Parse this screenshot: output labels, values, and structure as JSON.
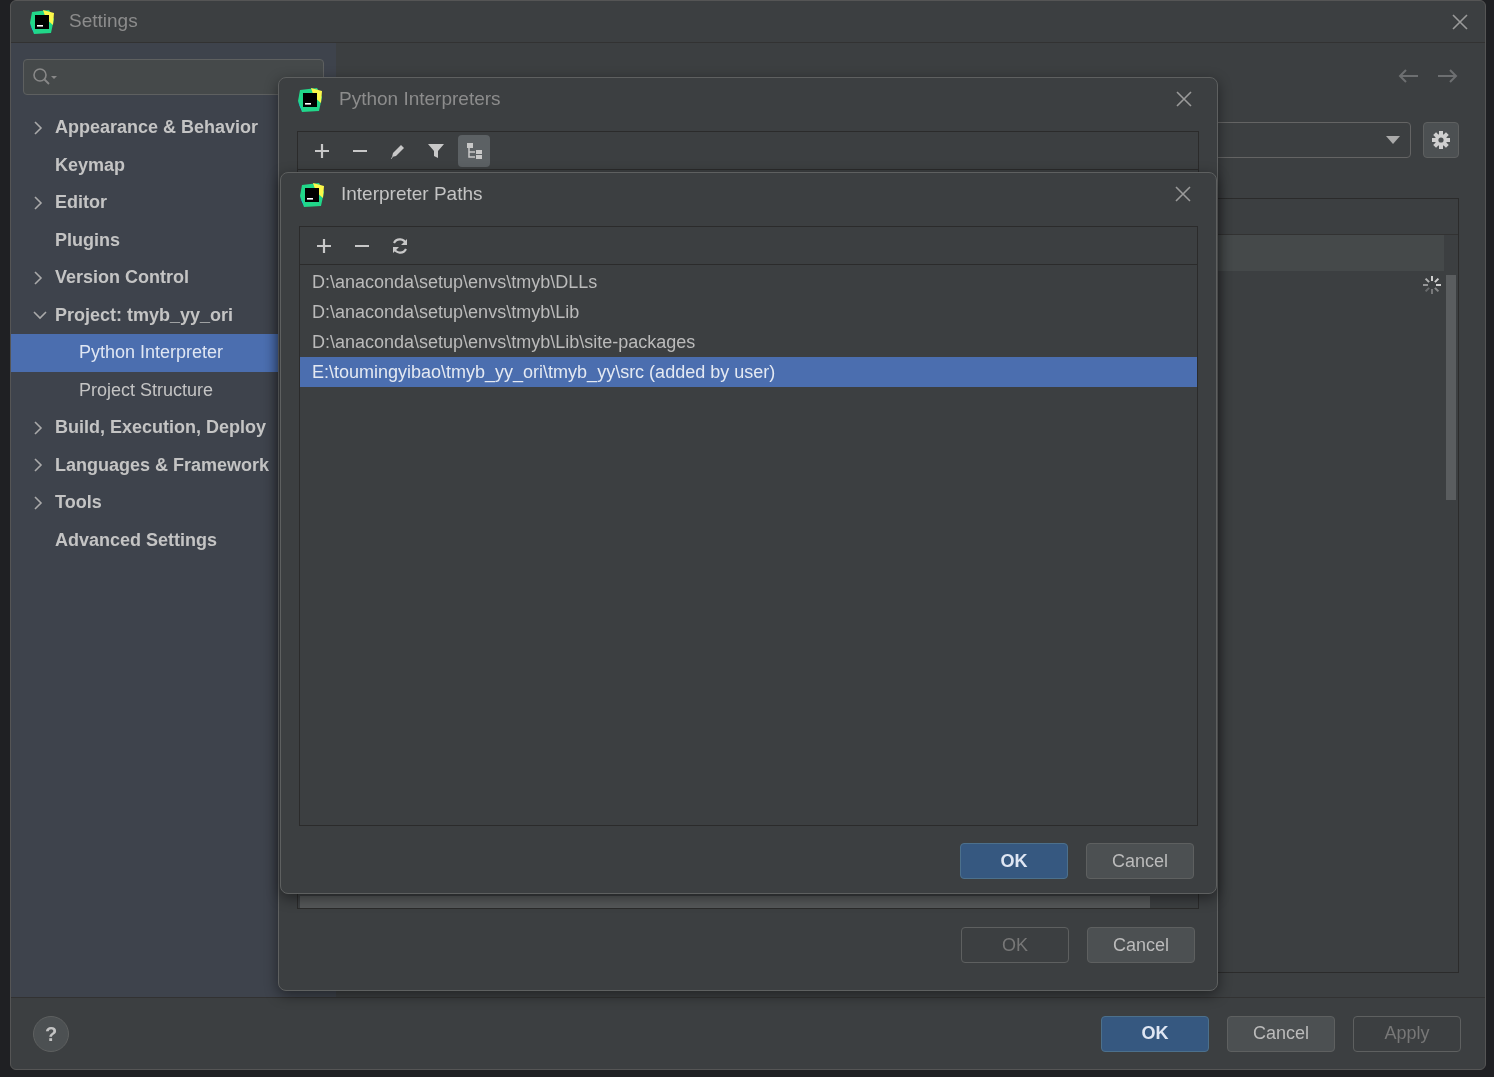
{
  "window": {
    "title": "Settings"
  },
  "sidebar": {
    "items": [
      {
        "label": "Appearance & Behavior",
        "expanded": false
      },
      {
        "label": "Keymap"
      },
      {
        "label": "Editor",
        "expanded": false
      },
      {
        "label": "Plugins"
      },
      {
        "label": "Version Control",
        "expanded": false
      },
      {
        "label": "Project: tmyb_yy_ori",
        "expanded": true,
        "children": [
          {
            "label": "Python Interpreter",
            "selected": true
          },
          {
            "label": "Project Structure",
            "selected": false
          }
        ]
      },
      {
        "label": "Build, Execution, Deploy",
        "expanded": false
      },
      {
        "label": "Languages & Framework",
        "expanded": false
      },
      {
        "label": "Tools",
        "expanded": false
      },
      {
        "label": "Advanced Settings"
      }
    ]
  },
  "interpreters_dialog": {
    "title": "Python Interpreters",
    "toolbar": [
      {
        "kind": "add",
        "on": false
      },
      {
        "kind": "remove",
        "on": false
      },
      {
        "kind": "edit",
        "on": false
      },
      {
        "kind": "filter",
        "on": false
      },
      {
        "kind": "tree",
        "on": true
      }
    ],
    "buttons": [
      {
        "label": "OK",
        "default": false,
        "disabled": true
      },
      {
        "label": "Cancel",
        "default": false,
        "disabled": false
      }
    ]
  },
  "paths_dialog": {
    "title": "Interpreter Paths",
    "toolbar": [
      {
        "kind": "add"
      },
      {
        "kind": "remove"
      },
      {
        "kind": "refresh"
      }
    ],
    "paths": [
      {
        "text": "D:\\anaconda\\setup\\envs\\tmyb\\DLLs",
        "selected": false
      },
      {
        "text": "D:\\anaconda\\setup\\envs\\tmyb\\Lib",
        "selected": false
      },
      {
        "text": "D:\\anaconda\\setup\\envs\\tmyb\\Lib\\site-packages",
        "selected": false
      },
      {
        "text": "E:\\toumingyibao\\tmyb_yy_ori\\tmyb_yy\\src  (added by user)",
        "selected": true
      }
    ],
    "buttons": [
      {
        "label": "OK",
        "default": true,
        "disabled": false
      },
      {
        "label": "Cancel",
        "default": false,
        "disabled": false
      }
    ]
  },
  "footer": {
    "help": "?",
    "buttons": [
      {
        "label": "OK",
        "default": true,
        "disabled": false
      },
      {
        "label": "Cancel",
        "default": false,
        "disabled": false
      },
      {
        "label": "Apply",
        "default": false,
        "disabled": true
      }
    ]
  }
}
